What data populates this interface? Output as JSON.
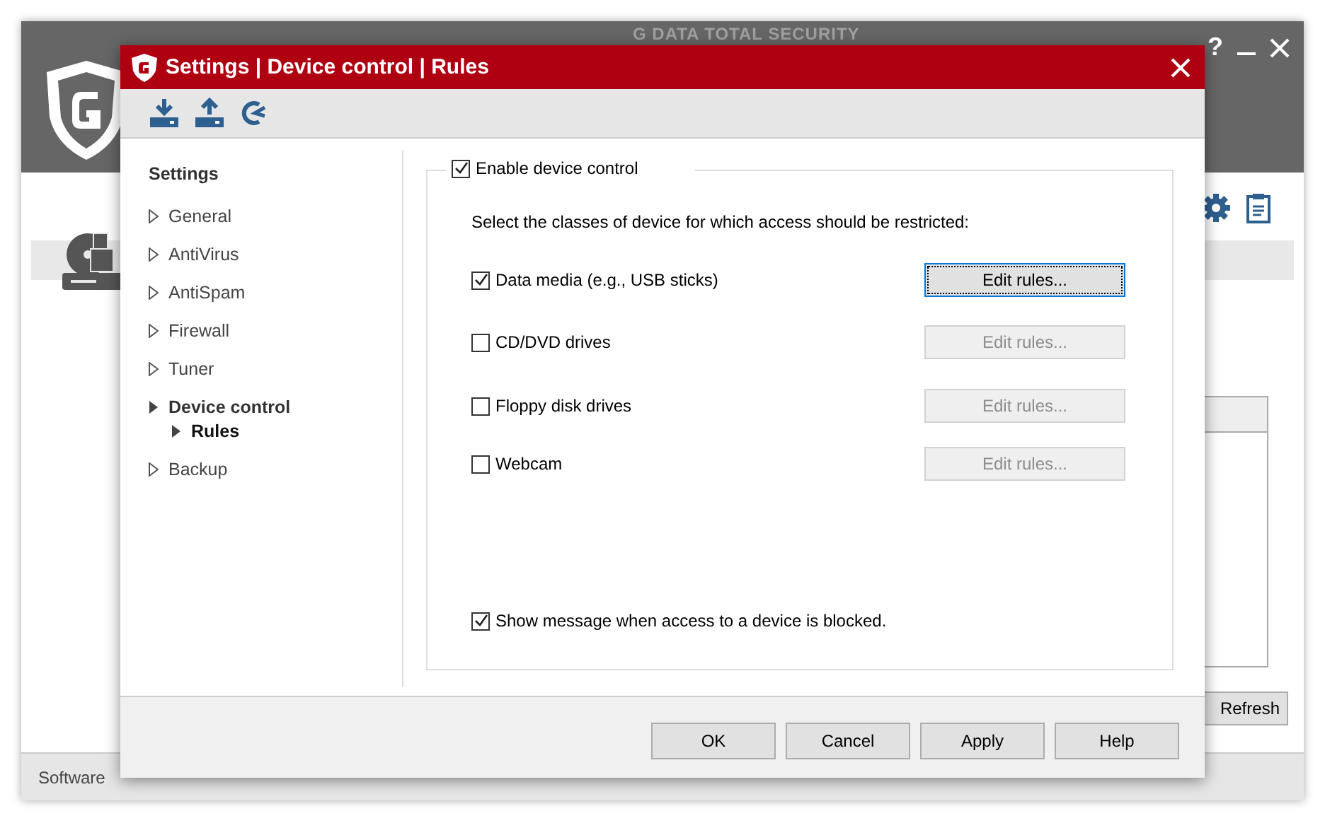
{
  "background_window": {
    "title": "G DATA TOTAL SECURITY",
    "help": "?",
    "refresh_button": "Refresh",
    "status_bar": "Software"
  },
  "dialog": {
    "title": "Settings | Device control | Rules",
    "sidebar": {
      "heading": "Settings",
      "items": [
        {
          "label": "General",
          "expanded": false,
          "selected": false
        },
        {
          "label": "AntiVirus",
          "expanded": false,
          "selected": false
        },
        {
          "label": "AntiSpam",
          "expanded": false,
          "selected": false
        },
        {
          "label": "Firewall",
          "expanded": false,
          "selected": false
        },
        {
          "label": "Tuner",
          "expanded": false,
          "selected": false
        },
        {
          "label": "Device control",
          "expanded": true,
          "selected": false,
          "children": [
            {
              "label": "Rules",
              "selected": true
            }
          ]
        },
        {
          "label": "Backup",
          "expanded": false,
          "selected": false
        }
      ]
    },
    "enable": {
      "label": "Enable device control",
      "checked": true
    },
    "instruction": "Select the classes of device for which access should be restricted:",
    "devices": [
      {
        "label": "Data media (e.g., USB sticks)",
        "checked": true,
        "button": {
          "label": "Edit rules...",
          "disabled": false,
          "focused": true
        }
      },
      {
        "label": "CD/DVD drives",
        "checked": false,
        "button": {
          "label": "Edit rules...",
          "disabled": true,
          "focused": false
        }
      },
      {
        "label": "Floppy disk drives",
        "checked": false,
        "button": {
          "label": "Edit rules...",
          "disabled": true,
          "focused": false
        }
      },
      {
        "label": "Webcam",
        "checked": false,
        "button": {
          "label": "Edit rules...",
          "disabled": true,
          "focused": false
        }
      }
    ],
    "show_message": {
      "label": "Show message when access to a device is blocked.",
      "checked": true
    },
    "buttons": [
      {
        "label": "OK"
      },
      {
        "label": "Cancel"
      },
      {
        "label": "Apply"
      },
      {
        "label": "Help"
      }
    ]
  }
}
